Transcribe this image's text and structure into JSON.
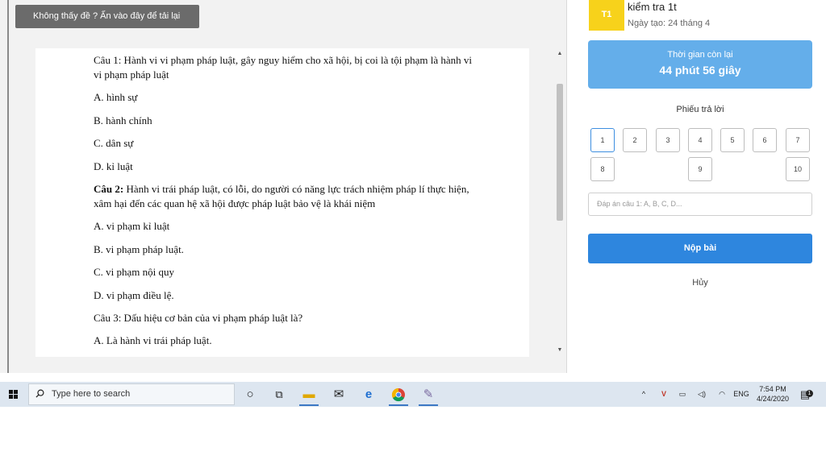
{
  "reload_button": "Không thấy đề ? Ấn vào đây để tải lại",
  "questions": [
    {
      "title_prefix": "",
      "title": "Câu 1: Hành vi vi phạm pháp luật, gây nguy hiểm cho xã hội, bị coi là tội phạm là hành vi vi phạm pháp luật",
      "options": [
        "A. hình sự",
        "B. hành chính",
        "C. dân sự",
        "D. kỉ luật"
      ]
    },
    {
      "title_prefix": "Câu 2:",
      "title": " Hành vi trái pháp luật, có lỗi, do người có năng lực trách nhiệm pháp lí thực hiện, xâm hại đến các quan hệ xã hội được pháp luật bảo vệ là khái niệm",
      "options": [
        "A. vi phạm kỉ luật",
        "B. vi phạm pháp luật.",
        "C. vi phạm nội quy",
        "D. vi phạm điều lệ."
      ]
    },
    {
      "title_prefix": "",
      "title": "Câu 3: Dấu hiệu cơ bản của vi phạm pháp luật là?",
      "options": [
        "A. Là hành vi trái pháp luật."
      ]
    }
  ],
  "test": {
    "avatar": "T1",
    "title": "kiểm tra 1t",
    "date": "Ngày tạo: 24 tháng 4"
  },
  "timer": {
    "label": "Thời gian còn lại",
    "value": "44 phút 56 giây"
  },
  "answer_sheet": {
    "title": "Phiếu trả lời",
    "numbers": [
      "1",
      "2",
      "3",
      "4",
      "5",
      "6",
      "7",
      "8",
      "9",
      "10"
    ],
    "active": "1"
  },
  "answer_input": {
    "placeholder": "Đáp án câu 1: A, B, C, D..."
  },
  "submit_label": "Nộp bài",
  "cancel_label": "Hủy",
  "taskbar": {
    "search_placeholder": "Type here to search",
    "lang": "ENG",
    "time": "7:54 PM",
    "date": "4/24/2020",
    "notification_count": "1"
  },
  "colors": {
    "timer_bg": "#64aeea",
    "submit_bg": "#2e86de",
    "avatar_bg": "#f7d21b"
  }
}
